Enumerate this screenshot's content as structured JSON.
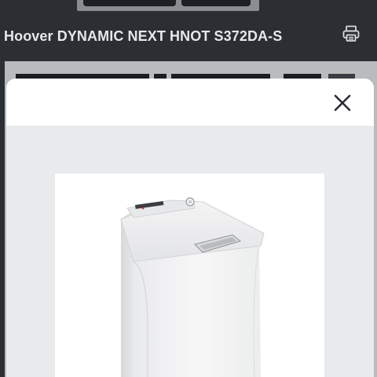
{
  "product": {
    "title": "Hoover DYNAMIC NEXT HNOT S372DA-S"
  },
  "icons": {
    "print": "printer-icon",
    "close": "close-icon"
  },
  "colors": {
    "header_bg": "#2b2f33",
    "modal_bg": "#e9eaec",
    "title_text": "#e6e8ea"
  }
}
